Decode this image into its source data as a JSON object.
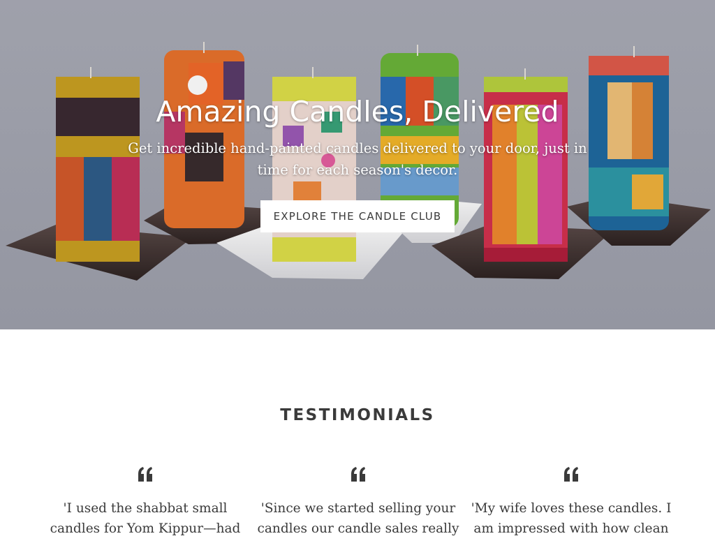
{
  "hero": {
    "title": "Amazing Candles, Delivered",
    "subtitle": "Get incredible hand-painted candles delivered to your door, just in time for each season's decor.",
    "cta_label": "EXPLORE THE CANDLE CLUB",
    "image_alt": "hand-painted-candles-photo"
  },
  "testimonials": {
    "heading": "TESTIMONIALS",
    "items": [
      {
        "quote_icon": "quote-icon",
        "text": "'I used the shabbat small candles for Yom Kippur—had"
      },
      {
        "quote_icon": "quote-icon",
        "text": "'Since we started selling your candles our candle sales really"
      },
      {
        "quote_icon": "quote-icon",
        "text": "'My wife loves these candles.  I am impressed with how clean"
      }
    ]
  },
  "colors": {
    "hero_bg": "#a3a5b1",
    "text_dark": "#3a3a3a",
    "button_bg": "#ffffff"
  }
}
